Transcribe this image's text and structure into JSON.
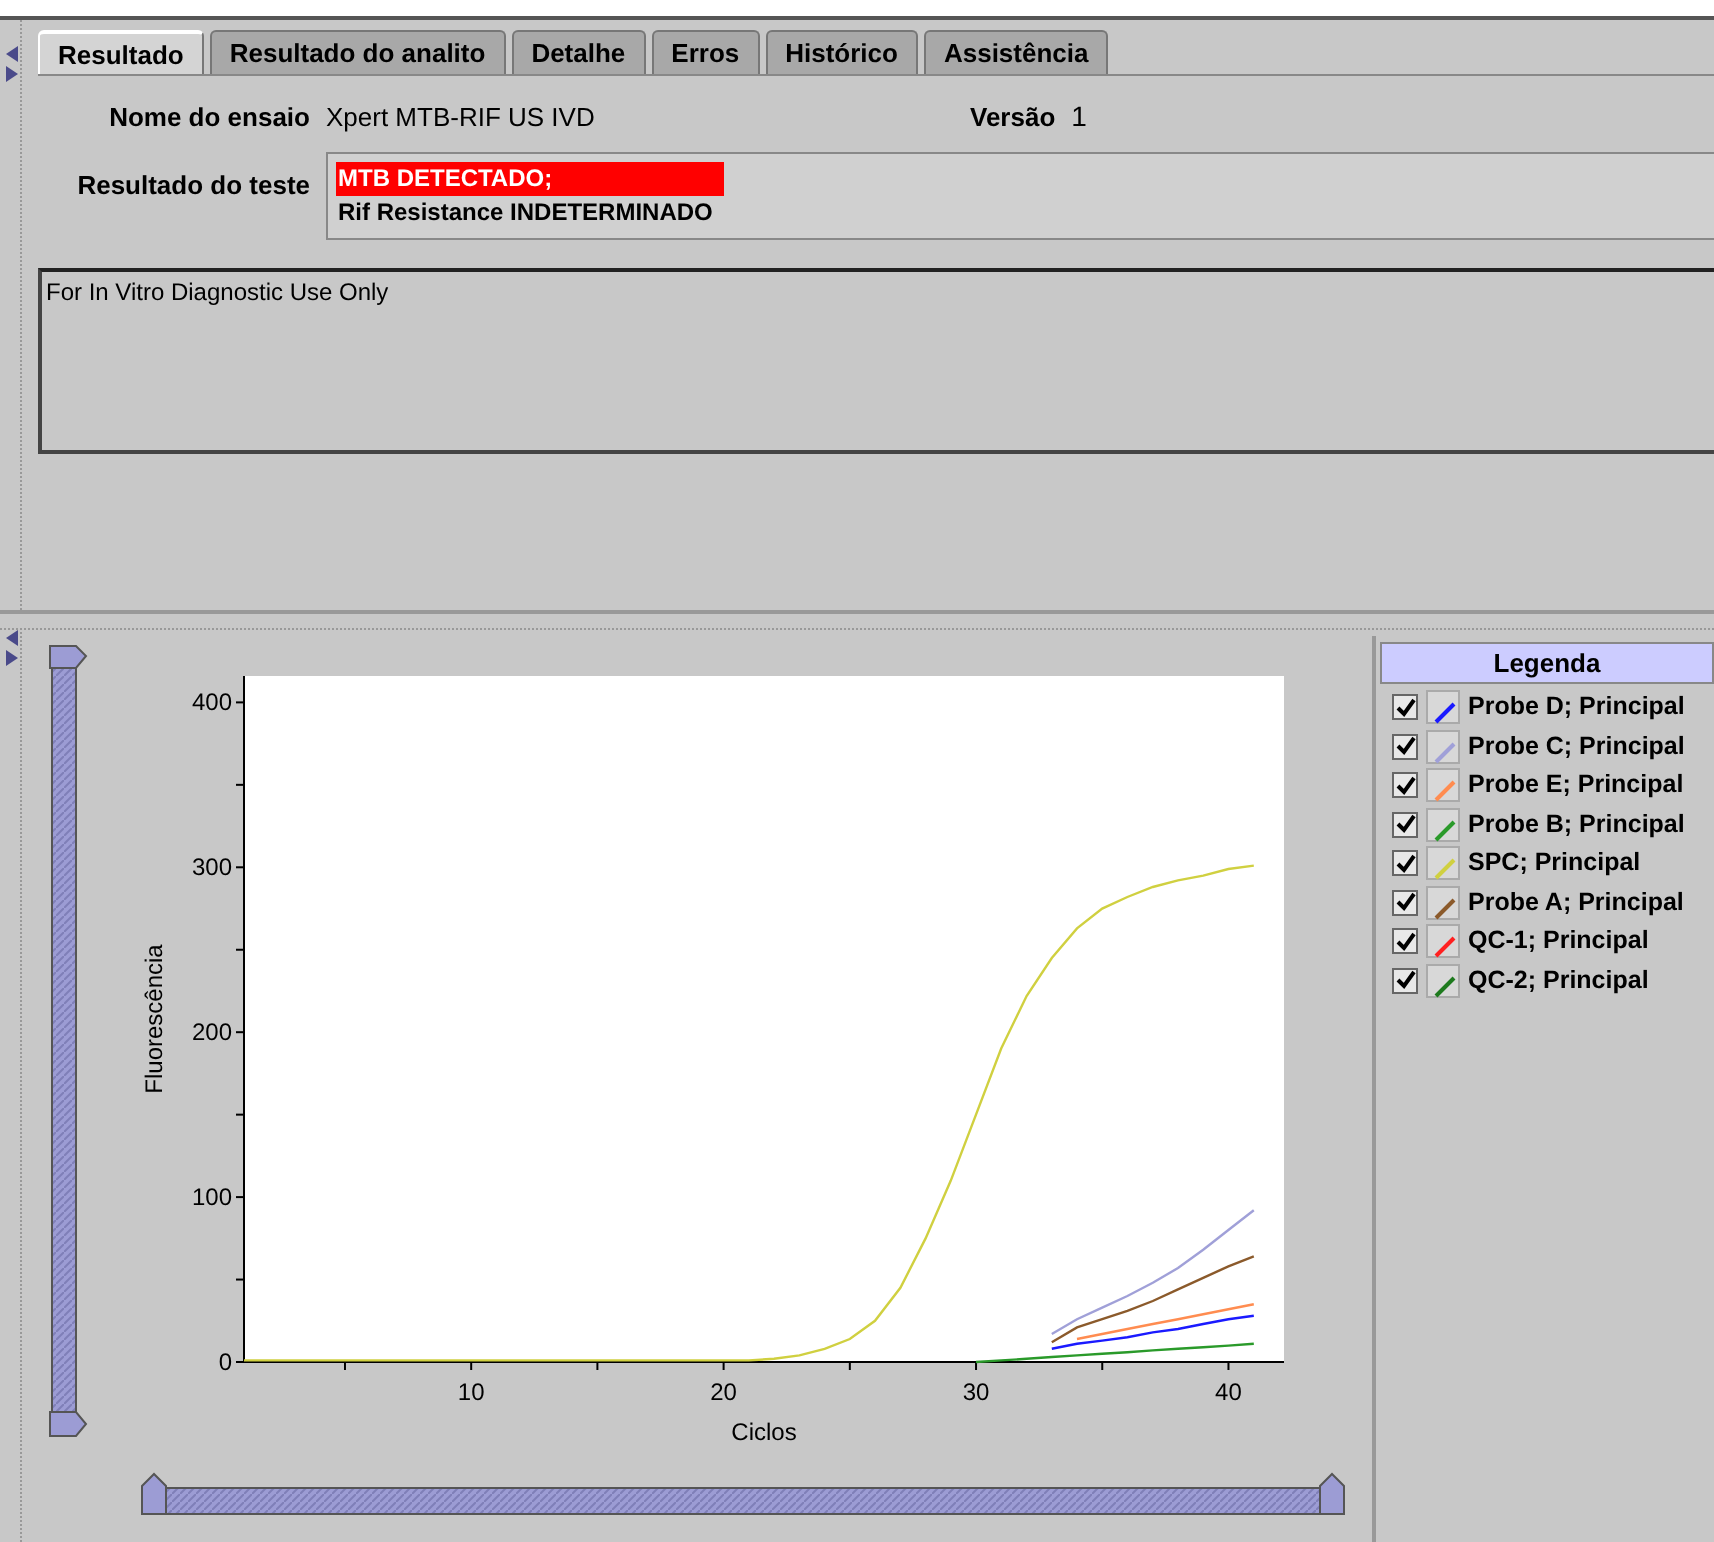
{
  "tabs": [
    {
      "label": "Resultado",
      "selected": true
    },
    {
      "label": "Resultado do analito",
      "selected": false
    },
    {
      "label": "Detalhe",
      "selected": false
    },
    {
      "label": "Erros",
      "selected": false
    },
    {
      "label": "Histórico",
      "selected": false
    },
    {
      "label": "Assistência",
      "selected": false
    }
  ],
  "assay": {
    "label": "Nome do ensaio",
    "value": "Xpert MTB-RIF US IVD"
  },
  "version": {
    "label": "Versão",
    "value": "1"
  },
  "test_result": {
    "label": "Resultado do teste",
    "lines": [
      {
        "text": "MTB DETECTADO;",
        "highlighted": true
      },
      {
        "text": "Rif Resistance INDETERMINADO",
        "highlighted": false
      }
    ]
  },
  "notes": "For In Vitro Diagnostic Use Only",
  "chart": {
    "chart_data": {
      "type": "line",
      "xlabel": "Ciclos",
      "ylabel": "Fluorescência",
      "xlim": [
        1,
        42.2
      ],
      "ylim": [
        0,
        416
      ],
      "xticks": [
        10,
        20,
        30,
        40
      ],
      "yticks": [
        0,
        100,
        200,
        300,
        400
      ],
      "x": [
        1,
        2,
        3,
        4,
        5,
        6,
        7,
        8,
        9,
        10,
        11,
        12,
        13,
        14,
        15,
        16,
        17,
        18,
        19,
        20,
        21,
        22,
        23,
        24,
        25,
        26,
        27,
        28,
        29,
        30,
        31,
        32,
        33,
        34,
        35,
        36,
        37,
        38,
        39,
        40,
        41
      ],
      "series": [
        {
          "color": "#1a1aff",
          "values": [
            null,
            null,
            null,
            null,
            null,
            null,
            null,
            null,
            null,
            null,
            null,
            null,
            null,
            null,
            null,
            null,
            null,
            null,
            null,
            null,
            null,
            null,
            null,
            null,
            null,
            null,
            null,
            null,
            null,
            null,
            null,
            null,
            8,
            11,
            13,
            15,
            18,
            20,
            23,
            26,
            28
          ]
        },
        {
          "color": "#a0a0d8",
          "values": [
            null,
            null,
            null,
            null,
            null,
            null,
            null,
            null,
            null,
            null,
            null,
            null,
            null,
            null,
            null,
            null,
            null,
            null,
            null,
            null,
            null,
            null,
            null,
            null,
            null,
            null,
            null,
            null,
            null,
            null,
            null,
            null,
            17,
            26,
            33,
            40,
            48,
            57,
            68,
            80,
            92
          ]
        },
        {
          "color": "#ff8c50",
          "values": [
            null,
            null,
            null,
            null,
            null,
            null,
            null,
            null,
            null,
            null,
            null,
            null,
            null,
            null,
            null,
            null,
            null,
            null,
            null,
            null,
            null,
            null,
            null,
            null,
            null,
            null,
            null,
            null,
            null,
            null,
            null,
            null,
            null,
            14,
            17,
            20,
            23,
            26,
            29,
            32,
            35
          ]
        },
        {
          "color": "#2a9a2a",
          "values": [
            null,
            null,
            null,
            null,
            null,
            null,
            null,
            null,
            null,
            null,
            null,
            null,
            null,
            null,
            null,
            null,
            null,
            null,
            null,
            null,
            null,
            null,
            null,
            null,
            null,
            null,
            null,
            null,
            null,
            0,
            1,
            2,
            3,
            4,
            5,
            6,
            7,
            8,
            9,
            10,
            11
          ]
        },
        {
          "color": "#d0d040",
          "values": [
            1,
            1,
            1,
            1,
            1,
            1,
            1,
            1,
            1,
            1,
            1,
            1,
            1,
            1,
            1,
            1,
            1,
            1,
            1,
            1,
            1,
            2,
            4,
            8,
            14,
            25,
            45,
            75,
            110,
            150,
            190,
            222,
            245,
            263,
            275,
            282,
            288,
            292,
            295,
            299,
            301
          ]
        },
        {
          "color": "#8b5a2b",
          "values": [
            null,
            null,
            null,
            null,
            null,
            null,
            null,
            null,
            null,
            null,
            null,
            null,
            null,
            null,
            null,
            null,
            null,
            null,
            null,
            null,
            null,
            null,
            null,
            null,
            null,
            null,
            null,
            null,
            null,
            null,
            null,
            null,
            12,
            21,
            26,
            31,
            37,
            44,
            51,
            58,
            64
          ]
        }
      ]
    }
  },
  "legend": {
    "title": "Legenda",
    "items": [
      {
        "label": "Probe D; Principal",
        "checked": true,
        "color": "#1a1aff"
      },
      {
        "label": "Probe C; Principal",
        "checked": true,
        "color": "#a0a0d8"
      },
      {
        "label": "Probe E; Principal",
        "checked": true,
        "color": "#ff8c50"
      },
      {
        "label": "Probe B; Principal",
        "checked": true,
        "color": "#2a9a2a"
      },
      {
        "label": "SPC; Principal",
        "checked": true,
        "color": "#d0d040"
      },
      {
        "label": "Probe A; Principal",
        "checked": true,
        "color": "#8b5a2b"
      },
      {
        "label": "QC-1; Principal",
        "checked": true,
        "color": "#ff2020"
      },
      {
        "label": "QC-2; Principal",
        "checked": true,
        "color": "#1e7a1e"
      }
    ]
  }
}
